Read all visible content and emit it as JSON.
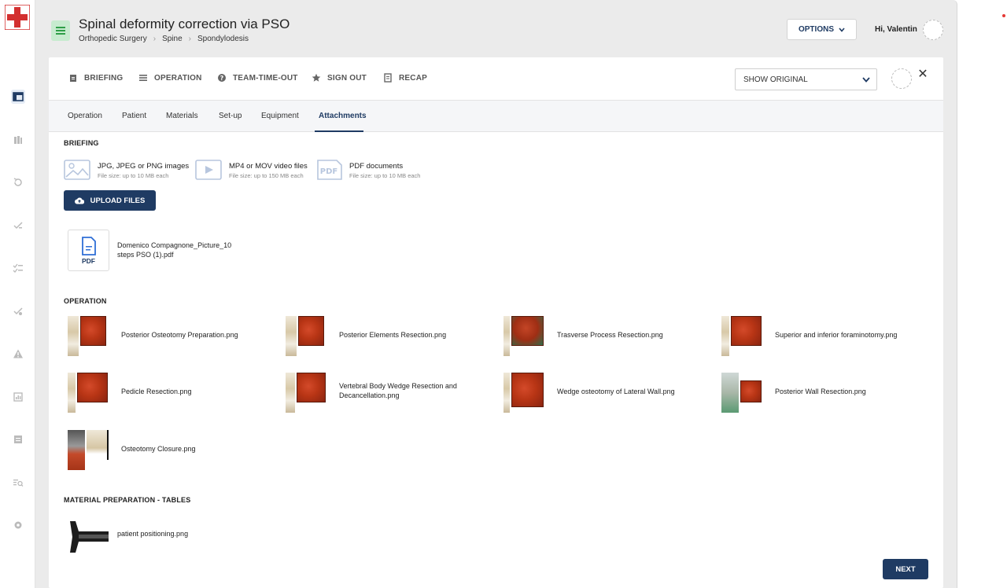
{
  "header": {
    "title": "Spinal deformity correction via PSO",
    "breadcrumbs": [
      "Orthopedic Surgery",
      "Spine",
      "Spondylodesis"
    ],
    "options_label": "OPTIONS",
    "greeting": "Hi, Valentin"
  },
  "phases": [
    {
      "label": "BRIEFING",
      "icon": "clipboard-icon"
    },
    {
      "label": "OPERATION",
      "icon": "list-icon"
    },
    {
      "label": "TEAM-TIME-OUT",
      "icon": "question-icon"
    },
    {
      "label": "SIGN OUT",
      "icon": "star-icon"
    },
    {
      "label": "RECAP",
      "icon": "document-icon"
    }
  ],
  "show_select": {
    "value": "SHOW ORIGINAL"
  },
  "tabs": [
    "Operation",
    "Patient",
    "Materials",
    "Set-up",
    "Equipment",
    "Attachments"
  ],
  "active_tab": "Attachments",
  "briefing": {
    "title": "BRIEFING",
    "file_types": [
      {
        "label": "JPG, JPEG or PNG images",
        "sub": "File size: up to 10 MB each",
        "icon": "image-icon"
      },
      {
        "label": "MP4 or MOV video files",
        "sub": "File size: up to 150 MB each",
        "icon": "video-icon"
      },
      {
        "label": "PDF documents",
        "sub": "File size: up to 10 MB each",
        "icon": "pdf-icon"
      }
    ],
    "upload_label": "UPLOAD FILES",
    "pdf_badge": "PDF",
    "pdf_file": "Domenico Compagnone_Picture_10 steps PSO (1).pdf"
  },
  "operation": {
    "title": "OPERATION",
    "files": [
      "Posterior Osteotomy Preparation.png",
      "Posterior Elements Resection.png",
      "Trasverse Process Resection.png",
      "Superior and inferior foraminotomy.png",
      "Pedicle Resection.png",
      "Vertebral Body Wedge Resection and Decancellation.png",
      "Wedge osteotomy of Lateral Wall.png",
      "Posterior Wall Resection.png",
      "Osteotomy Closure.png"
    ]
  },
  "material": {
    "title": "MATERIAL PREPARATION - TABLES",
    "files": [
      "patient positioning.png"
    ]
  },
  "next_label": "NEXT",
  "colors": {
    "primary": "#1f3b63",
    "menu_bg": "#c7ebcf",
    "accent_red": "#e53935"
  }
}
